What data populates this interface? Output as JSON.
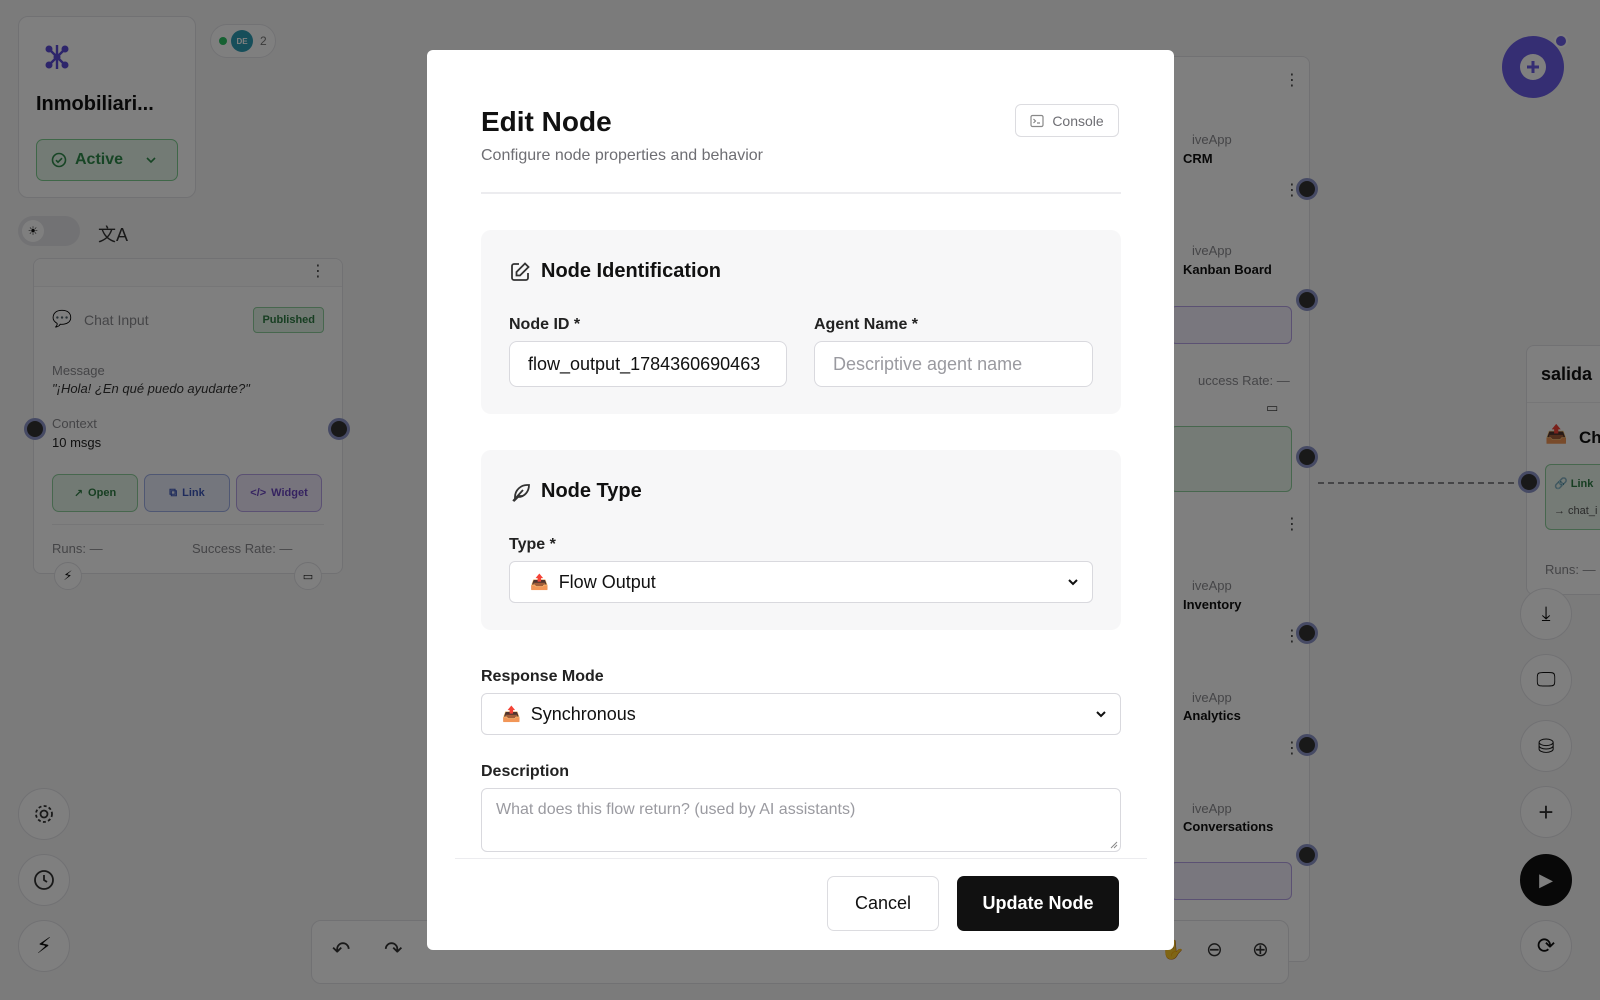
{
  "workspace": {
    "project_name": "Inmobiliari...",
    "status": "Active",
    "collab_initials": "DE",
    "collab_count": "2"
  },
  "chat_node": {
    "title": "Chat Input",
    "badge": "Published",
    "message_label": "Message",
    "message_value": "\"¡Hola! ¿En qué puedo ayudarte?\"",
    "context_label": "Context",
    "context_value": "10 msgs",
    "buttons": [
      "Open",
      "Link",
      "Widget"
    ],
    "runs": "Runs: —",
    "success_rate": "Success Rate: —"
  },
  "side_nodes": [
    {
      "app": "iveApp",
      "name": "CRM"
    },
    {
      "app": "iveApp",
      "name": "Kanban Board"
    },
    {
      "app": "iveApp",
      "name": "Inventory"
    },
    {
      "app": "iveApp",
      "name": "Analytics"
    },
    {
      "app": "iveApp",
      "name": "Conversations"
    }
  ],
  "side_success": "uccess Rate: —",
  "salida_node": {
    "title": "salida",
    "row": "Ch",
    "link": "Link",
    "sub": "→ chat_i",
    "runs": "Runs: —"
  },
  "modal": {
    "title": "Edit Node",
    "subtitle": "Configure node properties and behavior",
    "console_label": "Console",
    "identification": {
      "heading": "Node Identification",
      "node_id_label": "Node ID *",
      "node_id_value": "flow_output_1784360690463",
      "agent_name_label": "Agent Name *",
      "agent_name_placeholder": "Descriptive agent name"
    },
    "type_section": {
      "heading": "Node Type",
      "type_label": "Type *",
      "type_value": "Flow Output"
    },
    "response_mode_label": "Response Mode",
    "response_mode_value": "Synchronous",
    "description_label": "Description",
    "description_placeholder": "What does this flow return? (used by AI assistants)",
    "cancel_label": "Cancel",
    "submit_label": "Update Node"
  },
  "colors": {
    "accent": "#6b5ce7",
    "primary_button": "#111111",
    "status_green": "#2f8a4a"
  }
}
